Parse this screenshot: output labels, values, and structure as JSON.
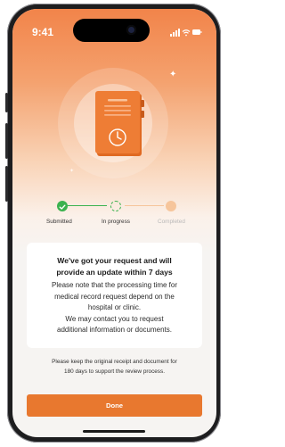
{
  "status_bar": {
    "time": "9:41",
    "icons": [
      "signal-icon",
      "wifi-icon",
      "battery-icon"
    ]
  },
  "hero": {
    "illustration": "document-clock-icon",
    "decorations": [
      "sparkle-icon",
      "sparkle-icon"
    ]
  },
  "progress": {
    "steps": [
      {
        "label": "Submitted",
        "state": "done",
        "icon": "check-icon"
      },
      {
        "label": "In progress",
        "state": "active",
        "icon": "dashed-circle-icon"
      },
      {
        "label": "Completed",
        "state": "pending",
        "icon": "dot-icon"
      }
    ]
  },
  "message_card": {
    "title_line1": "We've got your request and will",
    "title_line2": "provide an update within 7 days",
    "body_line1": "Please note that the processing time for",
    "body_line2": "medical record request depend on the",
    "body_line3": "hospital or clinic.",
    "body_line4": "We may contact you to request",
    "body_line5": "additional information or documents."
  },
  "note": {
    "line1": "Please keep the original receipt and document for",
    "line2": "180 days to support the review process."
  },
  "actions": {
    "done_label": "Done"
  },
  "colors": {
    "accent": "#e8782f",
    "success": "#3bb24f",
    "pending": "#f6c59b",
    "hero_top": "#f2844a",
    "background": "#f6f4f2"
  }
}
